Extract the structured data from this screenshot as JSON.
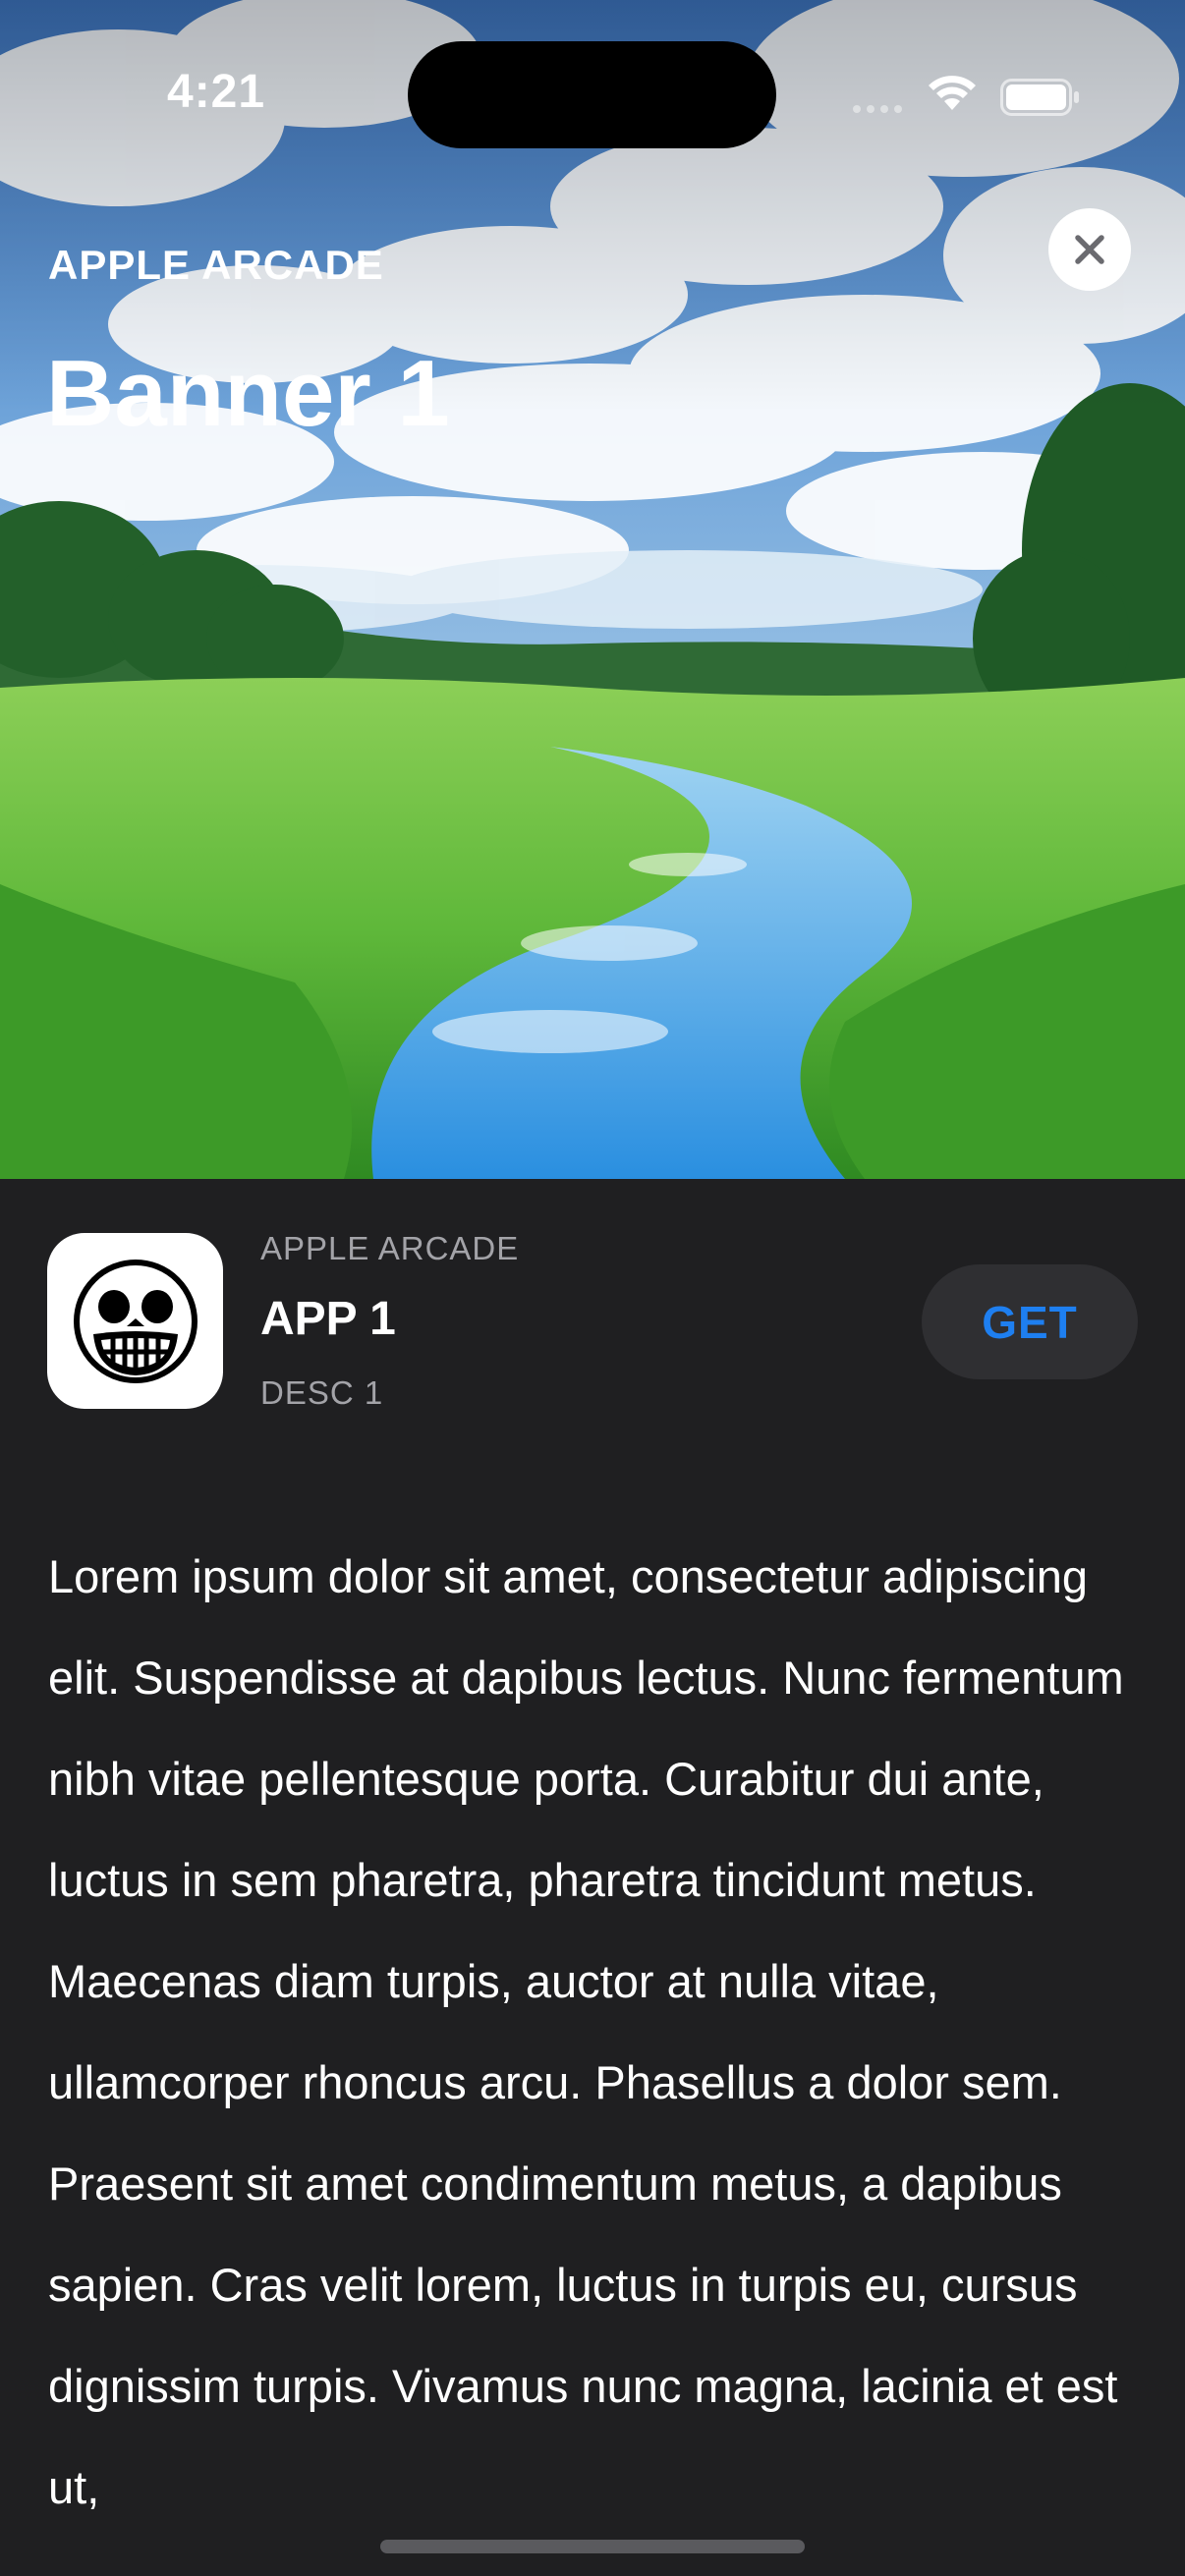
{
  "status_bar": {
    "time": "4:21"
  },
  "hero": {
    "subtitle": "APPLE ARCADE",
    "title": "Banner 1",
    "close_icon": "xmark-icon"
  },
  "app": {
    "category": "APPLE ARCADE",
    "name": "APP 1",
    "description": "DESC 1",
    "get_label": "GET",
    "icon": "smiley-skull-icon"
  },
  "article": {
    "body": "Lorem ipsum dolor sit amet, consectetur adipiscing elit. Suspendisse at dapibus lectus. Nunc fermentum nibh vitae pellentesque porta. Curabitur dui ante, luctus in sem pharetra, pharetra tincidunt metus. Maecenas diam turpis, auctor at nulla vitae, ullamcorper rhoncus arcu. Phasellus a dolor sem. Praesent sit amet condimentum metus, a dapibus sapien. Cras velit lorem, luctus in turpis eu, cursus dignissim turpis. Vivamus nunc magna, lacinia et est ut,"
  },
  "colors": {
    "background": "#1f1f21",
    "accent": "#1e7ff0",
    "secondary_text": "#a3a3a8",
    "button_bg": "#2f2f32"
  }
}
